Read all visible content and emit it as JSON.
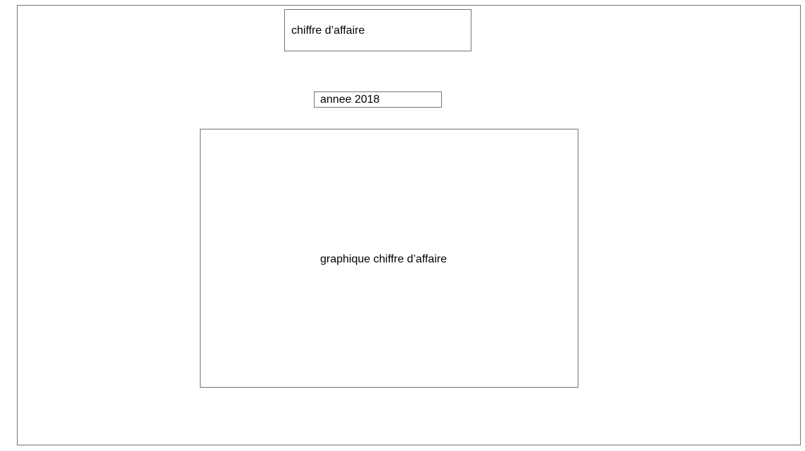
{
  "page": {
    "title": "chiffre d’affaire",
    "year_selector_value": "annee 2018",
    "chart_placeholder_label": "graphique chiffre d’affaire"
  },
  "colors": {
    "border": "#6b7580",
    "background": "#ffffff",
    "text": "#000000"
  }
}
